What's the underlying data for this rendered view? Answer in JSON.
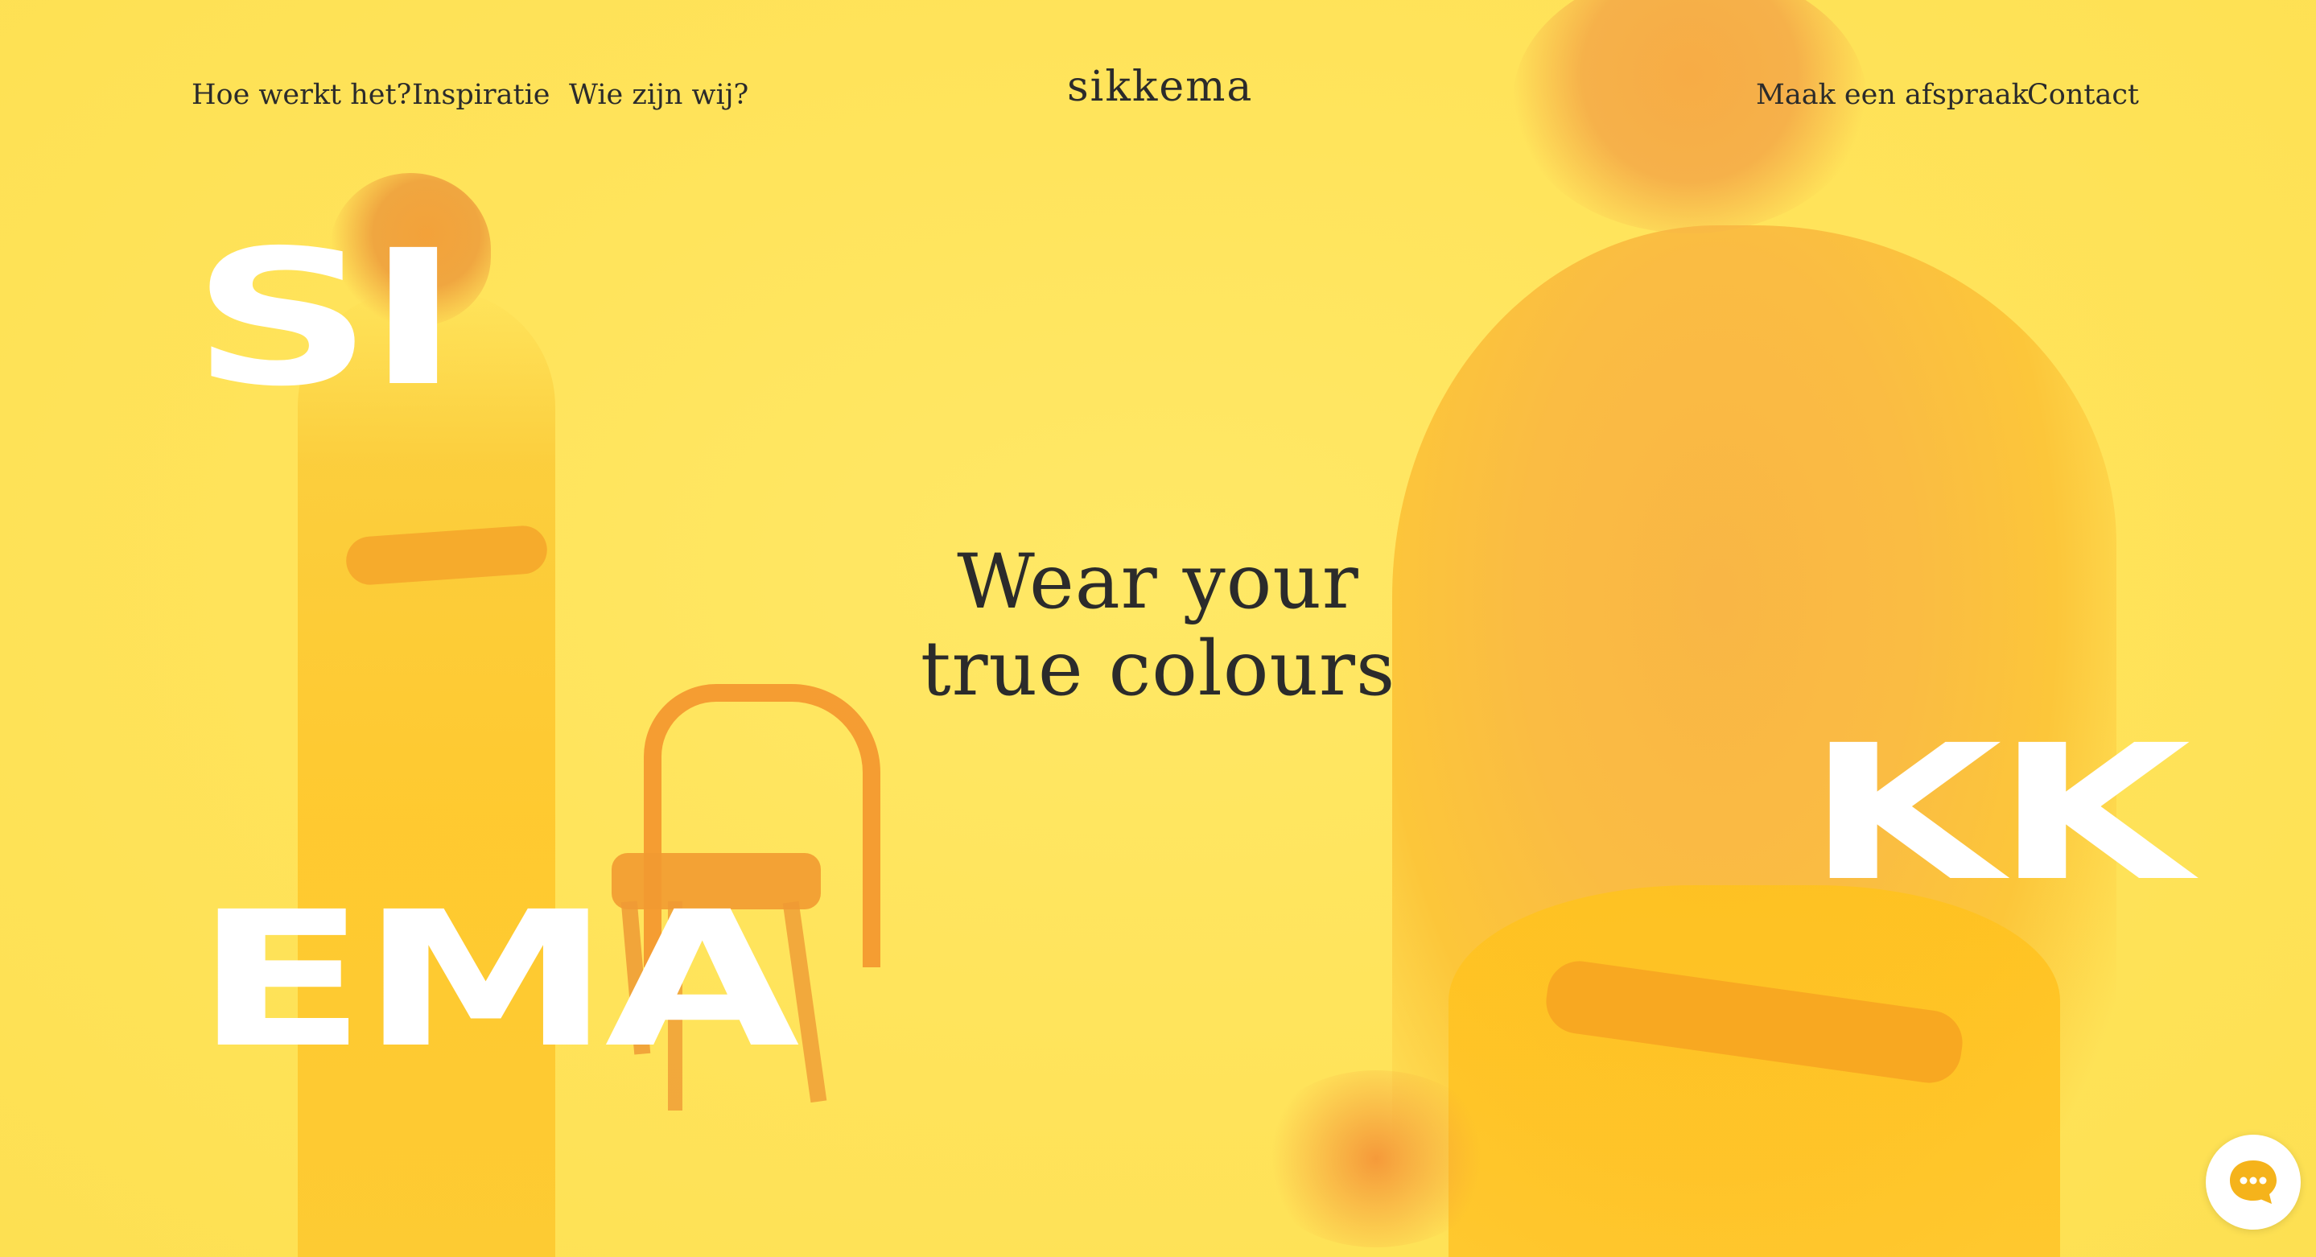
{
  "nav": {
    "left": [
      {
        "label": "Hoe werkt het?"
      },
      {
        "label": "Inspiratie"
      },
      {
        "label": "Wie zijn wij?"
      }
    ],
    "right": [
      {
        "label": "Maak een afspraak"
      },
      {
        "label": "Contact"
      }
    ]
  },
  "logo": "sikkema",
  "hero": {
    "letters": {
      "top_left": "SI",
      "bottom_left": "EMA",
      "right": "KK"
    },
    "tagline": [
      "Wear your",
      "true colours"
    ]
  },
  "chat": {
    "icon": "chat-bubble-icon"
  },
  "colors": {
    "background": "#ffe45c",
    "text": "#2b2b2b",
    "chat_icon": "#f5b31b",
    "letters": "#ffffff"
  }
}
